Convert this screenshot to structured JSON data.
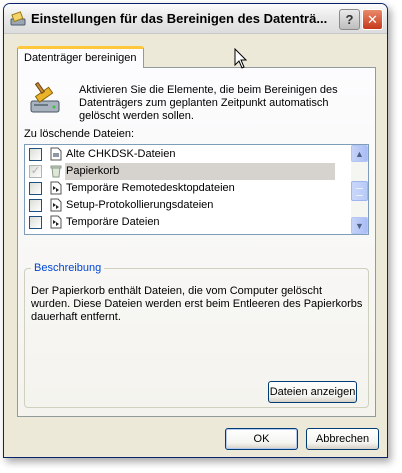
{
  "window": {
    "title": "Einstellungen für das Bereinigen des Datenträ...",
    "help_button": "?",
    "close_button": "✕"
  },
  "tabs": [
    {
      "label": "Datenträger bereinigen",
      "active": true
    }
  ],
  "intro": {
    "text": "Aktivieren Sie die Elemente, die beim Bereinigen des Datenträgers zum geplanten Zeitpunkt automatisch gelöscht werden sollen."
  },
  "file_list": {
    "label": "Zu löschende Dateien:",
    "items": [
      {
        "label": "Alte CHKDSK-Dateien",
        "checked": false,
        "icon": "chkdsk-file-icon"
      },
      {
        "label": "Papierkorb",
        "checked": true,
        "disabled": true,
        "selected": true,
        "icon": "recycle-bin-icon"
      },
      {
        "label": "Temporäre Remotedesktopdateien",
        "checked": false,
        "icon": "remote-desktop-file-icon"
      },
      {
        "label": "Setup-Protokollierungsdateien",
        "checked": false,
        "icon": "log-file-icon"
      },
      {
        "label": "Temporäre Dateien",
        "checked": false,
        "icon": "temp-file-icon"
      }
    ]
  },
  "description": {
    "title": "Beschreibung",
    "text": "Der Papierkorb enthält Dateien, die vom Computer gelöscht wurden. Diese Dateien werden erst beim Entleeren des Papierkorbs dauerhaft entfernt.",
    "show_files_button": "Dateien anzeigen"
  },
  "footer": {
    "ok_button": "OK",
    "cancel_button": "Abbrechen"
  },
  "colors": {
    "window_bg": "#ece9d8",
    "accent_tab": "#ffc83c",
    "group_title": "#0046d5"
  }
}
